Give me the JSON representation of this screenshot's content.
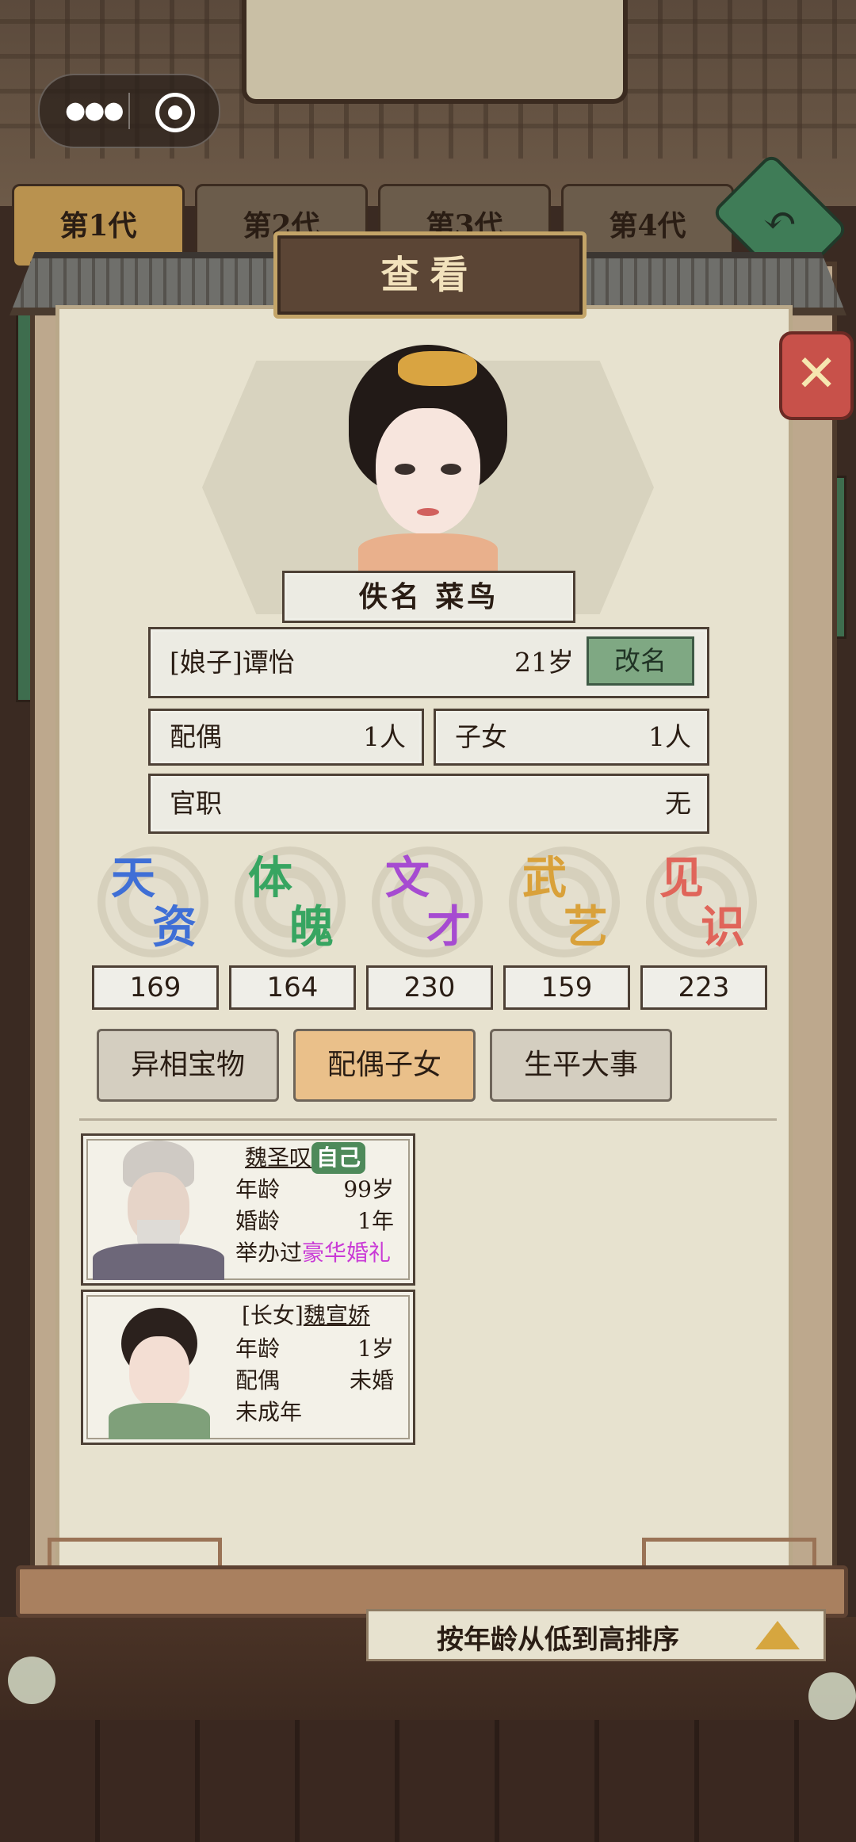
{
  "tabs": [
    "第1代",
    "第2代",
    "第3代",
    "第4代"
  ],
  "dialog": {
    "title": "查看"
  },
  "character": {
    "nickname": "佚名 菜鸟",
    "name": "[娘子]谭怡",
    "age": "21岁",
    "rename_label": "改名",
    "spouse_label": "配偶",
    "spouse_value": "1人",
    "children_label": "子女",
    "children_value": "1人",
    "office_label": "官职",
    "office_value": "无"
  },
  "attributes": [
    {
      "c1": "天",
      "c2": "资",
      "value": "169",
      "color": "#3f6fd6"
    },
    {
      "c1": "体",
      "c2": "魄",
      "value": "164",
      "color": "#37a561"
    },
    {
      "c1": "文",
      "c2": "才",
      "value": "230",
      "color": "#a64bd1"
    },
    {
      "c1": "武",
      "c2": "艺",
      "value": "159",
      "color": "#d9a13a"
    },
    {
      "c1": "见",
      "c2": "识",
      "value": "223",
      "color": "#e0655a"
    }
  ],
  "section_tabs": [
    "异相宝物",
    "配偶子女",
    "生平大事"
  ],
  "members": [
    {
      "name": "魏圣叹",
      "tag": "自己",
      "line1_label": "年龄",
      "line1_value": "99岁",
      "line2_label": "婚龄",
      "line2_value": "1年",
      "line3_prefix": "举办过",
      "line3_highlight": "豪华婚礼"
    },
    {
      "prefix": "[长女]",
      "name": "魏宣娇",
      "line1_label": "年龄",
      "line1_value": "1岁",
      "line2_label": "配偶",
      "line2_value": "未婚",
      "line3": "未成年"
    }
  ],
  "sort_label": "按年龄从低到高排序"
}
